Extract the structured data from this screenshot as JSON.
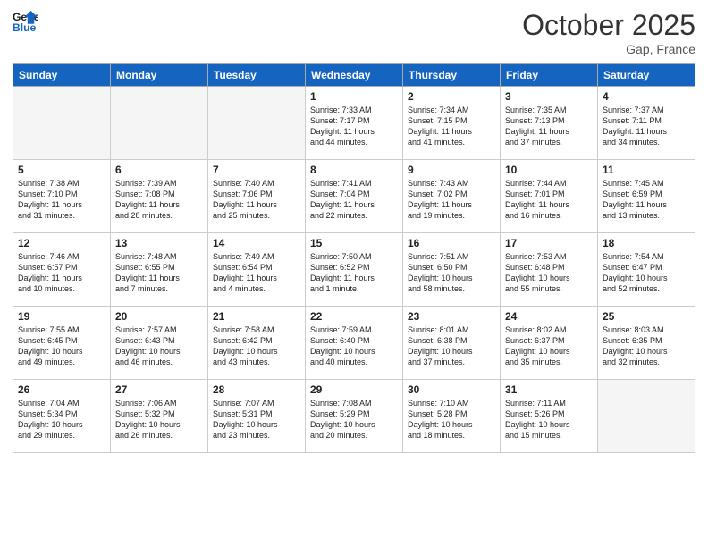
{
  "header": {
    "logo_line1": "General",
    "logo_line2": "Blue",
    "month": "October 2025",
    "location": "Gap, France"
  },
  "weekdays": [
    "Sunday",
    "Monday",
    "Tuesday",
    "Wednesday",
    "Thursday",
    "Friday",
    "Saturday"
  ],
  "weeks": [
    [
      {
        "day": "",
        "text": "",
        "empty": true
      },
      {
        "day": "",
        "text": "",
        "empty": true
      },
      {
        "day": "",
        "text": "",
        "empty": true
      },
      {
        "day": "1",
        "text": "Sunrise: 7:33 AM\nSunset: 7:17 PM\nDaylight: 11 hours\nand 44 minutes.",
        "empty": false
      },
      {
        "day": "2",
        "text": "Sunrise: 7:34 AM\nSunset: 7:15 PM\nDaylight: 11 hours\nand 41 minutes.",
        "empty": false
      },
      {
        "day": "3",
        "text": "Sunrise: 7:35 AM\nSunset: 7:13 PM\nDaylight: 11 hours\nand 37 minutes.",
        "empty": false
      },
      {
        "day": "4",
        "text": "Sunrise: 7:37 AM\nSunset: 7:11 PM\nDaylight: 11 hours\nand 34 minutes.",
        "empty": false
      }
    ],
    [
      {
        "day": "5",
        "text": "Sunrise: 7:38 AM\nSunset: 7:10 PM\nDaylight: 11 hours\nand 31 minutes.",
        "empty": false
      },
      {
        "day": "6",
        "text": "Sunrise: 7:39 AM\nSunset: 7:08 PM\nDaylight: 11 hours\nand 28 minutes.",
        "empty": false
      },
      {
        "day": "7",
        "text": "Sunrise: 7:40 AM\nSunset: 7:06 PM\nDaylight: 11 hours\nand 25 minutes.",
        "empty": false
      },
      {
        "day": "8",
        "text": "Sunrise: 7:41 AM\nSunset: 7:04 PM\nDaylight: 11 hours\nand 22 minutes.",
        "empty": false
      },
      {
        "day": "9",
        "text": "Sunrise: 7:43 AM\nSunset: 7:02 PM\nDaylight: 11 hours\nand 19 minutes.",
        "empty": false
      },
      {
        "day": "10",
        "text": "Sunrise: 7:44 AM\nSunset: 7:01 PM\nDaylight: 11 hours\nand 16 minutes.",
        "empty": false
      },
      {
        "day": "11",
        "text": "Sunrise: 7:45 AM\nSunset: 6:59 PM\nDaylight: 11 hours\nand 13 minutes.",
        "empty": false
      }
    ],
    [
      {
        "day": "12",
        "text": "Sunrise: 7:46 AM\nSunset: 6:57 PM\nDaylight: 11 hours\nand 10 minutes.",
        "empty": false
      },
      {
        "day": "13",
        "text": "Sunrise: 7:48 AM\nSunset: 6:55 PM\nDaylight: 11 hours\nand 7 minutes.",
        "empty": false
      },
      {
        "day": "14",
        "text": "Sunrise: 7:49 AM\nSunset: 6:54 PM\nDaylight: 11 hours\nand 4 minutes.",
        "empty": false
      },
      {
        "day": "15",
        "text": "Sunrise: 7:50 AM\nSunset: 6:52 PM\nDaylight: 11 hours\nand 1 minute.",
        "empty": false
      },
      {
        "day": "16",
        "text": "Sunrise: 7:51 AM\nSunset: 6:50 PM\nDaylight: 10 hours\nand 58 minutes.",
        "empty": false
      },
      {
        "day": "17",
        "text": "Sunrise: 7:53 AM\nSunset: 6:48 PM\nDaylight: 10 hours\nand 55 minutes.",
        "empty": false
      },
      {
        "day": "18",
        "text": "Sunrise: 7:54 AM\nSunset: 6:47 PM\nDaylight: 10 hours\nand 52 minutes.",
        "empty": false
      }
    ],
    [
      {
        "day": "19",
        "text": "Sunrise: 7:55 AM\nSunset: 6:45 PM\nDaylight: 10 hours\nand 49 minutes.",
        "empty": false
      },
      {
        "day": "20",
        "text": "Sunrise: 7:57 AM\nSunset: 6:43 PM\nDaylight: 10 hours\nand 46 minutes.",
        "empty": false
      },
      {
        "day": "21",
        "text": "Sunrise: 7:58 AM\nSunset: 6:42 PM\nDaylight: 10 hours\nand 43 minutes.",
        "empty": false
      },
      {
        "day": "22",
        "text": "Sunrise: 7:59 AM\nSunset: 6:40 PM\nDaylight: 10 hours\nand 40 minutes.",
        "empty": false
      },
      {
        "day": "23",
        "text": "Sunrise: 8:01 AM\nSunset: 6:38 PM\nDaylight: 10 hours\nand 37 minutes.",
        "empty": false
      },
      {
        "day": "24",
        "text": "Sunrise: 8:02 AM\nSunset: 6:37 PM\nDaylight: 10 hours\nand 35 minutes.",
        "empty": false
      },
      {
        "day": "25",
        "text": "Sunrise: 8:03 AM\nSunset: 6:35 PM\nDaylight: 10 hours\nand 32 minutes.",
        "empty": false
      }
    ],
    [
      {
        "day": "26",
        "text": "Sunrise: 7:04 AM\nSunset: 5:34 PM\nDaylight: 10 hours\nand 29 minutes.",
        "empty": false
      },
      {
        "day": "27",
        "text": "Sunrise: 7:06 AM\nSunset: 5:32 PM\nDaylight: 10 hours\nand 26 minutes.",
        "empty": false
      },
      {
        "day": "28",
        "text": "Sunrise: 7:07 AM\nSunset: 5:31 PM\nDaylight: 10 hours\nand 23 minutes.",
        "empty": false
      },
      {
        "day": "29",
        "text": "Sunrise: 7:08 AM\nSunset: 5:29 PM\nDaylight: 10 hours\nand 20 minutes.",
        "empty": false
      },
      {
        "day": "30",
        "text": "Sunrise: 7:10 AM\nSunset: 5:28 PM\nDaylight: 10 hours\nand 18 minutes.",
        "empty": false
      },
      {
        "day": "31",
        "text": "Sunrise: 7:11 AM\nSunset: 5:26 PM\nDaylight: 10 hours\nand 15 minutes.",
        "empty": false
      },
      {
        "day": "",
        "text": "",
        "empty": true
      }
    ]
  ]
}
